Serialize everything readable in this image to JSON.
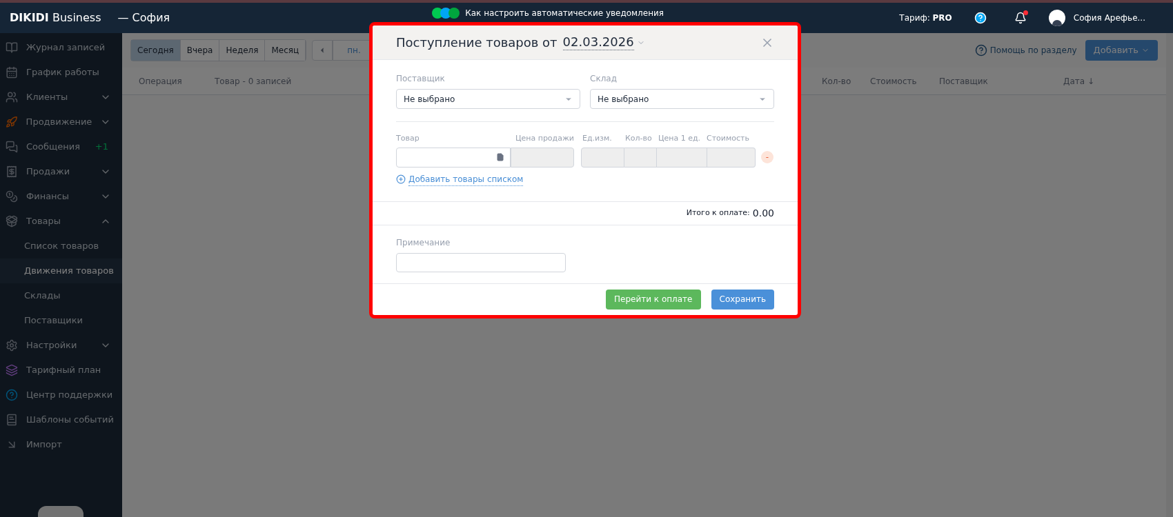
{
  "header": {
    "brand": "DIKIDI",
    "product": "Business",
    "separator": "—",
    "account": "София",
    "promo": "Как настроить автоматические уведомления",
    "tariff_label": "Тариф:",
    "tariff": "PRO",
    "user": "София Арефье..."
  },
  "sidebar": {
    "items": [
      {
        "label": "Журнал записей"
      },
      {
        "label": "График работы"
      },
      {
        "label": "Клиенты",
        "expanded": false
      },
      {
        "label": "Продвижение",
        "expanded": false
      },
      {
        "label": "Сообщения",
        "badge": "+1"
      },
      {
        "label": "Продажи",
        "expanded": false
      },
      {
        "label": "Финансы",
        "expanded": false
      },
      {
        "label": "Товары",
        "expanded": true,
        "children": [
          {
            "label": "Список товаров",
            "selected": false
          },
          {
            "label": "Движения товаров",
            "selected": true
          },
          {
            "label": "Склады",
            "selected": false
          },
          {
            "label": "Поставщики",
            "selected": false
          }
        ]
      },
      {
        "label": "Настройки",
        "expanded": false
      },
      {
        "label": "Тарифный план"
      },
      {
        "label": "Центр поддержки"
      },
      {
        "label": "Шаблоны событий"
      },
      {
        "label": "Импорт"
      }
    ]
  },
  "toolbar": {
    "periods": [
      {
        "label": "Сегодня",
        "selected": true
      },
      {
        "label": "Вчера",
        "selected": false
      },
      {
        "label": "Неделя",
        "selected": false
      },
      {
        "label": "Месяц",
        "selected": false
      }
    ],
    "date": "пн.",
    "help": "Помощь по разделу",
    "add": "Добавить"
  },
  "table": {
    "columns": [
      "Операция",
      "Товар - 0 записей",
      "Кол-во",
      "Стоимость",
      "Поставщик",
      "Дата ↓"
    ]
  },
  "modal": {
    "title": "Поступление товаров от",
    "date": "02.03.2026",
    "supplier": {
      "label": "Поставщик",
      "value": "Не выбрано"
    },
    "warehouse": {
      "label": "Склад",
      "value": "Не выбрано"
    },
    "item_columns": [
      "Товар",
      "Цена продажи",
      "Ед.изм.",
      "Кол-во",
      "Цена 1 ед.",
      "Стоимость"
    ],
    "remove": "-",
    "add_list": "Добавить товары списком",
    "total_label": "Итого к оплате:",
    "total": "0.00",
    "note": {
      "label": "Примечание"
    },
    "buttons": [
      {
        "label": "Перейти к оплате",
        "kind": "pay"
      },
      {
        "label": "Сохранить",
        "kind": "save"
      }
    ]
  }
}
